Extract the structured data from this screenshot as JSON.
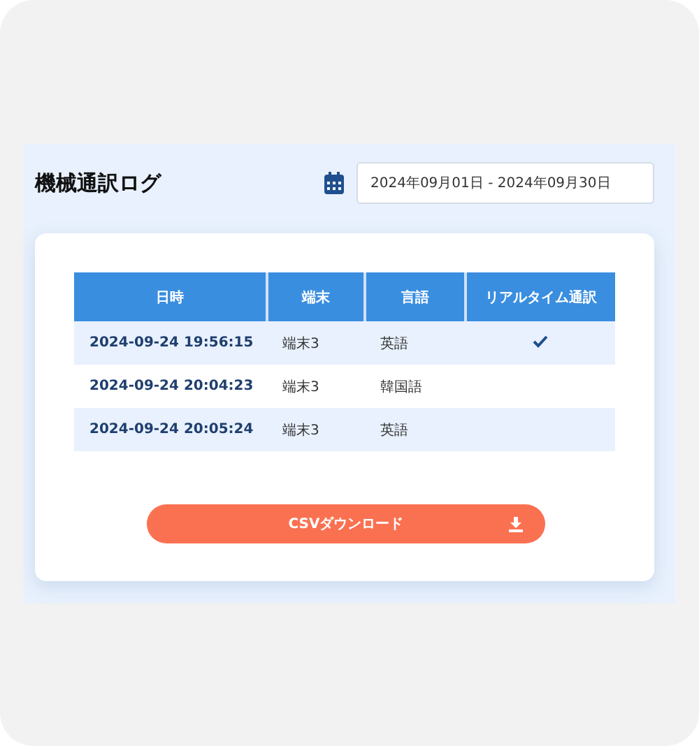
{
  "title": "機械通訳ログ",
  "date_range": {
    "value": "2024年09月01日 - 2024年09月30日"
  },
  "table": {
    "columns": [
      "日時",
      "端末",
      "言語",
      "リアルタイム通訳"
    ],
    "rows": [
      {
        "datetime": "2024-09-24 19:56:15",
        "device": "端末3",
        "language": "英語",
        "realtime": true
      },
      {
        "datetime": "2024-09-24 20:04:23",
        "device": "端末3",
        "language": "韓国語",
        "realtime": false
      },
      {
        "datetime": "2024-09-24 20:05:24",
        "device": "端末3",
        "language": "英語",
        "realtime": false
      }
    ]
  },
  "download_button": {
    "label": "CSVダウンロード"
  }
}
